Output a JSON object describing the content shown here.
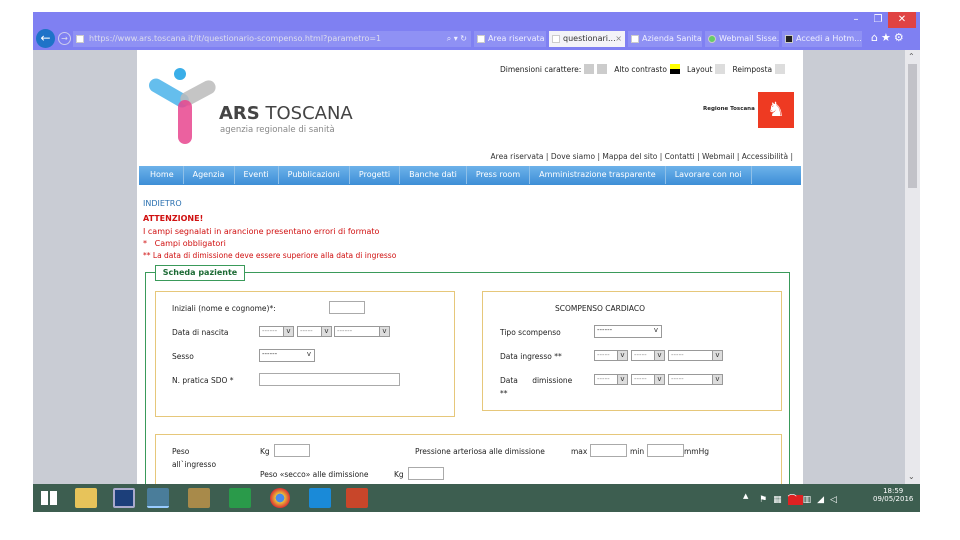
{
  "browser": {
    "url": "https://www.ars.toscana.it/it/questionario-scompenso.html?parametro=1",
    "tabs": [
      {
        "label": "Area riservata"
      },
      {
        "label": "questionari...",
        "active": true
      },
      {
        "label": "Azienda Sanita..."
      },
      {
        "label": "Webmail Sisse..."
      },
      {
        "label": "Accedi a Hotm..."
      }
    ],
    "window_buttons": {
      "minimize": "–",
      "restore": "❐",
      "close": "✕"
    },
    "colors": {
      "chrome": "#7f80f2",
      "close": "#e04343"
    }
  },
  "header": {
    "logo_title_bold": "ARS",
    "logo_title": "TOSCANA",
    "logo_subtitle": "agenzia regionale di sanità",
    "font_size_label": "Dimensioni carattere:",
    "contrast_label": "Alto contrasto",
    "layout_label": "Layout",
    "reset_label": "Reimposta",
    "region_label": "Regione Toscana",
    "top_links": [
      "Area riservata",
      "Dove siamo",
      "Mappa del sito",
      "Contatti",
      "Webmail",
      "Accessibilità"
    ]
  },
  "nav": {
    "items": [
      "Home",
      "Agenzia",
      "Eventi",
      "Pubblicazioni",
      "Progetti",
      "Banche dati",
      "Press room",
      "Amministrazione trasparente",
      "Lavorare con noi"
    ],
    "color": "#4a98d8"
  },
  "messages": {
    "back": "INDIETRO",
    "attention": "ATTENZIONE!",
    "format_errors": "I campi segnalati in arancione presentano errori di formato",
    "required_mark": "*",
    "required": "Campi obbligatori",
    "date_mark": "**",
    "date_rule": "La data di dimissione deve essere superiore alla data di ingresso"
  },
  "form": {
    "legend": "Scheda paziente",
    "patient": {
      "initials_label": "Iniziali (nome e cognome)*:",
      "initials_value": "",
      "birth_label": "Data di nascita",
      "birth": [
        "------",
        "-----",
        "------"
      ],
      "sex_label": "Sesso",
      "sex": "------",
      "sdo_label": "N. pratica SDO *",
      "sdo_value": ""
    },
    "cardiac": {
      "title": "SCOMPENSO CARDIACO",
      "type_label": "Tipo scompenso",
      "type": "------",
      "in_label": "Data ingresso **",
      "in": [
        "-----",
        "-----",
        "-----"
      ],
      "out_label": "Data      dimissione",
      "out_mark": "**",
      "out": [
        "-----",
        "-----",
        "-----"
      ]
    },
    "vitals": {
      "weight_label": "Peso",
      "weight_label2": "all`ingresso",
      "kg": "Kg",
      "bp_label": "Pressione arteriosa alle dimissione",
      "max": "max",
      "min": "min",
      "unit": "mmHg",
      "dry_label": "Peso «secco» alle dimissione",
      "kg2": "Kg"
    }
  },
  "taskbar": {
    "time": "18:59",
    "date": "09/05/2016",
    "chevron": "▲"
  }
}
